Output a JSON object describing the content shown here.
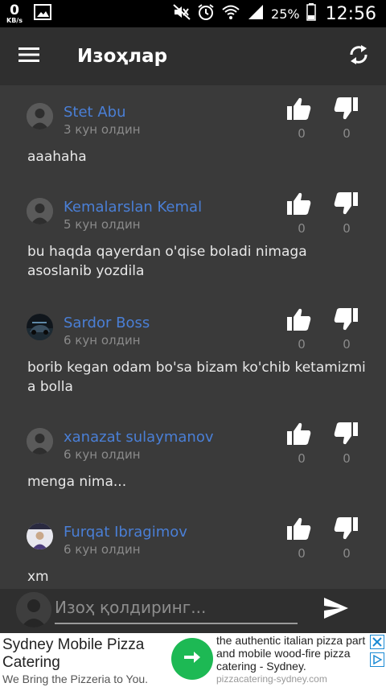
{
  "status_bar": {
    "net_speed_value": "0",
    "net_speed_unit": "KB/s",
    "battery_percent": "25%",
    "time": "12:56"
  },
  "app_bar": {
    "title": "Изоҳлар",
    "menu_icon": "hamburger-menu-icon",
    "refresh_icon": "refresh-icon"
  },
  "comments": [
    {
      "author": "Stet Abu",
      "time": "3 кун олдин",
      "likes": "0",
      "dislikes": "0",
      "text": "aaahaha"
    },
    {
      "author": "Kemalarslan Kemal",
      "time": "5 кун олдин",
      "likes": "0",
      "dislikes": "0",
      "text": "bu haqda qayerdan o'qise boladi nimaga asoslanib yozdila"
    },
    {
      "author": "Sardor Boss",
      "time": "6 кун олдин",
      "likes": "0",
      "dislikes": "0",
      "text": "borib kegan odam bo'sa bizam ko'chib ketamizmi a bolla"
    },
    {
      "author": "xanazat sulaymanov",
      "time": "6 кун олдин",
      "likes": "0",
      "dislikes": "0",
      "text": "menga nima..."
    },
    {
      "author": "Furqat Ibragimov",
      "time": "6 кун олдин",
      "likes": "0",
      "dislikes": "0",
      "text": "xm"
    }
  ],
  "input_bar": {
    "placeholder": "Изоҳ қолдиринг...",
    "value": ""
  },
  "ad": {
    "title": "Sydney Mobile Pizza Catering",
    "subtitle": "We Bring the Pizzeria to You.",
    "text_line1": "the authentic italian pizza part",
    "text_line2": "and mobile wood-fire pizza",
    "text_line3": "catering - Sydney.",
    "url": "pizzacatering-sydney.com"
  },
  "colors": {
    "author_link": "#4a7fd6",
    "list_bg": "#3a3a3a",
    "appbar_bg": "#2f2f2f",
    "ad_cta": "#1db954"
  }
}
